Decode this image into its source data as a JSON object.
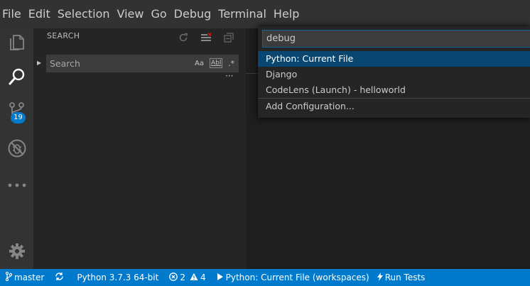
{
  "menu": [
    "File",
    "Edit",
    "Selection",
    "View",
    "Go",
    "Debug",
    "Terminal",
    "Help"
  ],
  "activity_bar": {
    "items": [
      {
        "icon": "explorer-icon"
      },
      {
        "icon": "search-icon"
      },
      {
        "icon": "source-control-icon",
        "badge": "19"
      },
      {
        "icon": "no-bugs-icon"
      },
      {
        "icon": "more-icon"
      }
    ],
    "bottom": {
      "icon": "gear-icon"
    }
  },
  "sidebar": {
    "title": "SEARCH",
    "search_placeholder": "Search",
    "opt_case": "Aa",
    "opt_word": "Abl",
    "opt_regex": ".*",
    "more": "···"
  },
  "quick_pick": {
    "value": "debug",
    "items": [
      {
        "label": "Python: Current File",
        "selected": true
      },
      {
        "label": "Django"
      },
      {
        "label": "CodeLens (Launch) - helloworld"
      },
      {
        "label": "Add Configuration...",
        "separator": true
      }
    ]
  },
  "status_bar": {
    "branch": "master",
    "interpreter": "Python 3.7.3 64-bit",
    "errors": "2",
    "warnings": "4",
    "debug_config": "Python: Current File (workspaces)",
    "run_tests": "Run Tests"
  },
  "colors": {
    "accent": "#007acc",
    "selection": "#094771",
    "focus_border": "#0e639c"
  }
}
